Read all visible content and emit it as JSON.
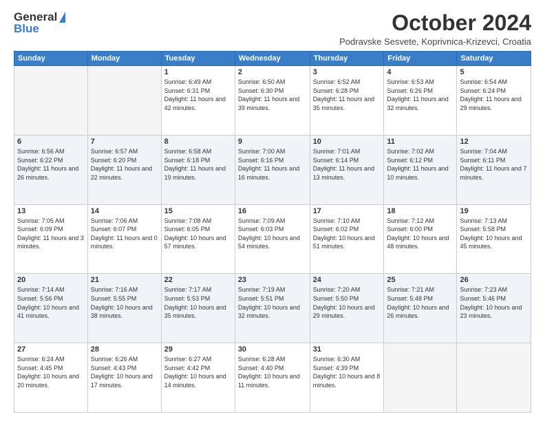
{
  "logo": {
    "general": "General",
    "blue": "Blue"
  },
  "title": "October 2024",
  "subtitle": "Podravske Sesvete, Koprivnica-Krizevci, Croatia",
  "days_of_week": [
    "Sunday",
    "Monday",
    "Tuesday",
    "Wednesday",
    "Thursday",
    "Friday",
    "Saturday"
  ],
  "weeks": [
    [
      {
        "day": "",
        "info": ""
      },
      {
        "day": "",
        "info": ""
      },
      {
        "day": "1",
        "info": "Sunrise: 6:49 AM\nSunset: 6:31 PM\nDaylight: 11 hours and 42 minutes."
      },
      {
        "day": "2",
        "info": "Sunrise: 6:50 AM\nSunset: 6:30 PM\nDaylight: 11 hours and 39 minutes."
      },
      {
        "day": "3",
        "info": "Sunrise: 6:52 AM\nSunset: 6:28 PM\nDaylight: 11 hours and 35 minutes."
      },
      {
        "day": "4",
        "info": "Sunrise: 6:53 AM\nSunset: 6:26 PM\nDaylight: 11 hours and 32 minutes."
      },
      {
        "day": "5",
        "info": "Sunrise: 6:54 AM\nSunset: 6:24 PM\nDaylight: 11 hours and 29 minutes."
      }
    ],
    [
      {
        "day": "6",
        "info": "Sunrise: 6:56 AM\nSunset: 6:22 PM\nDaylight: 11 hours and 26 minutes."
      },
      {
        "day": "7",
        "info": "Sunrise: 6:57 AM\nSunset: 6:20 PM\nDaylight: 11 hours and 22 minutes."
      },
      {
        "day": "8",
        "info": "Sunrise: 6:58 AM\nSunset: 6:18 PM\nDaylight: 11 hours and 19 minutes."
      },
      {
        "day": "9",
        "info": "Sunrise: 7:00 AM\nSunset: 6:16 PM\nDaylight: 11 hours and 16 minutes."
      },
      {
        "day": "10",
        "info": "Sunrise: 7:01 AM\nSunset: 6:14 PM\nDaylight: 11 hours and 13 minutes."
      },
      {
        "day": "11",
        "info": "Sunrise: 7:02 AM\nSunset: 6:12 PM\nDaylight: 11 hours and 10 minutes."
      },
      {
        "day": "12",
        "info": "Sunrise: 7:04 AM\nSunset: 6:11 PM\nDaylight: 11 hours and 7 minutes."
      }
    ],
    [
      {
        "day": "13",
        "info": "Sunrise: 7:05 AM\nSunset: 6:09 PM\nDaylight: 11 hours and 3 minutes."
      },
      {
        "day": "14",
        "info": "Sunrise: 7:06 AM\nSunset: 6:07 PM\nDaylight: 11 hours and 0 minutes."
      },
      {
        "day": "15",
        "info": "Sunrise: 7:08 AM\nSunset: 6:05 PM\nDaylight: 10 hours and 57 minutes."
      },
      {
        "day": "16",
        "info": "Sunrise: 7:09 AM\nSunset: 6:03 PM\nDaylight: 10 hours and 54 minutes."
      },
      {
        "day": "17",
        "info": "Sunrise: 7:10 AM\nSunset: 6:02 PM\nDaylight: 10 hours and 51 minutes."
      },
      {
        "day": "18",
        "info": "Sunrise: 7:12 AM\nSunset: 6:00 PM\nDaylight: 10 hours and 48 minutes."
      },
      {
        "day": "19",
        "info": "Sunrise: 7:13 AM\nSunset: 5:58 PM\nDaylight: 10 hours and 45 minutes."
      }
    ],
    [
      {
        "day": "20",
        "info": "Sunrise: 7:14 AM\nSunset: 5:56 PM\nDaylight: 10 hours and 41 minutes."
      },
      {
        "day": "21",
        "info": "Sunrise: 7:16 AM\nSunset: 5:55 PM\nDaylight: 10 hours and 38 minutes."
      },
      {
        "day": "22",
        "info": "Sunrise: 7:17 AM\nSunset: 5:53 PM\nDaylight: 10 hours and 35 minutes."
      },
      {
        "day": "23",
        "info": "Sunrise: 7:19 AM\nSunset: 5:51 PM\nDaylight: 10 hours and 32 minutes."
      },
      {
        "day": "24",
        "info": "Sunrise: 7:20 AM\nSunset: 5:50 PM\nDaylight: 10 hours and 29 minutes."
      },
      {
        "day": "25",
        "info": "Sunrise: 7:21 AM\nSunset: 5:48 PM\nDaylight: 10 hours and 26 minutes."
      },
      {
        "day": "26",
        "info": "Sunrise: 7:23 AM\nSunset: 5:46 PM\nDaylight: 10 hours and 23 minutes."
      }
    ],
    [
      {
        "day": "27",
        "info": "Sunrise: 6:24 AM\nSunset: 4:45 PM\nDaylight: 10 hours and 20 minutes."
      },
      {
        "day": "28",
        "info": "Sunrise: 6:26 AM\nSunset: 4:43 PM\nDaylight: 10 hours and 17 minutes."
      },
      {
        "day": "29",
        "info": "Sunrise: 6:27 AM\nSunset: 4:42 PM\nDaylight: 10 hours and 14 minutes."
      },
      {
        "day": "30",
        "info": "Sunrise: 6:28 AM\nSunset: 4:40 PM\nDaylight: 10 hours and 11 minutes."
      },
      {
        "day": "31",
        "info": "Sunrise: 6:30 AM\nSunset: 4:39 PM\nDaylight: 10 hours and 8 minutes."
      },
      {
        "day": "",
        "info": ""
      },
      {
        "day": "",
        "info": ""
      }
    ]
  ]
}
